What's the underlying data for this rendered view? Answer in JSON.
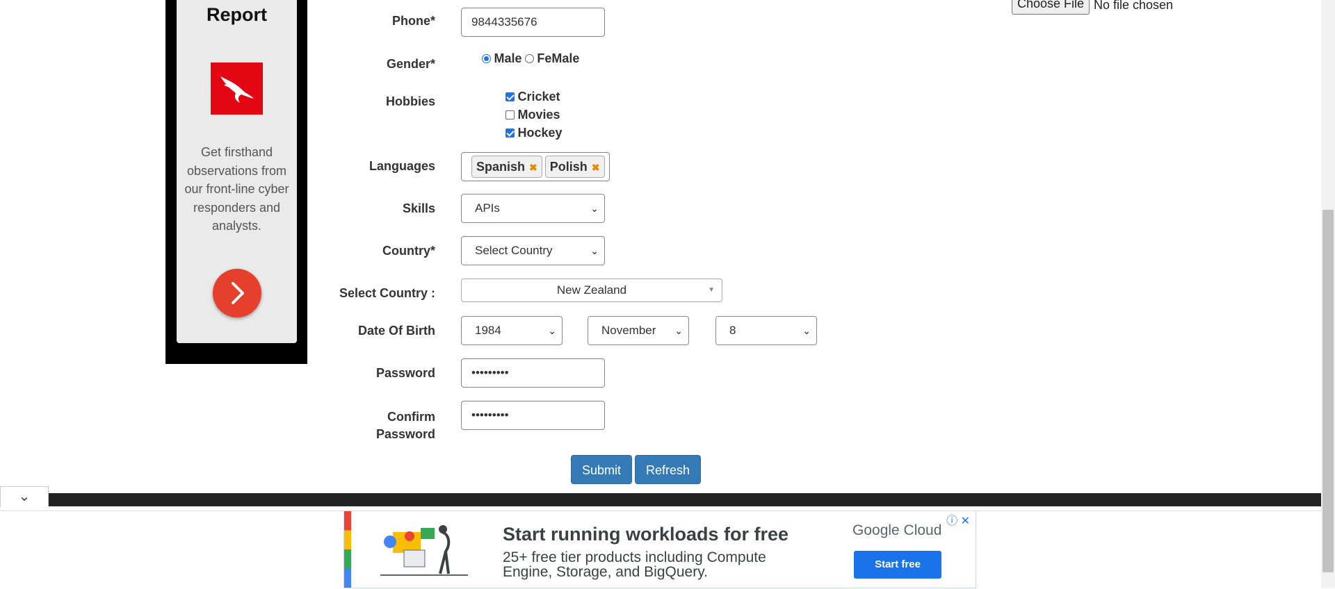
{
  "sidebar_ad": {
    "title": "Report",
    "text": "Get firsthand observations from our front-line cyber responders and analysts.",
    "logo_icon": "eagle-logo-icon",
    "arrow_icon": "chevron-right-icon"
  },
  "file_upload": {
    "button_label": "Choose File",
    "status": "No file chosen"
  },
  "form": {
    "phone": {
      "label": "Phone*",
      "value": "9844335676"
    },
    "gender": {
      "label": "Gender*",
      "options": [
        "Male",
        "FeMale"
      ],
      "selected": "Male"
    },
    "hobbies": {
      "label": "Hobbies",
      "items": [
        {
          "label": "Cricket",
          "checked": true
        },
        {
          "label": "Movies",
          "checked": false
        },
        {
          "label": "Hockey",
          "checked": true
        }
      ]
    },
    "languages": {
      "label": "Languages",
      "tags": [
        "Spanish",
        "Polish"
      ]
    },
    "skills": {
      "label": "Skills",
      "value": "APIs"
    },
    "country": {
      "label": "Country*",
      "value": "Select Country"
    },
    "select_country": {
      "label": "Select Country :",
      "value": "New Zealand"
    },
    "dob": {
      "label": "Date Of Birth",
      "year": "1984",
      "month": "November",
      "day": "8"
    },
    "password": {
      "label": "Password",
      "value": "•••••••••"
    },
    "confirm_password": {
      "label_line1": "Confirm",
      "label_line2": "Password",
      "value": "•••••••••"
    },
    "submit_label": "Submit",
    "refresh_label": "Refresh"
  },
  "ad_banner": {
    "headline": "Start running workloads for free",
    "subtext": "25+ free tier products including Compute Engine, Storage, and BigQuery.",
    "brand": "Google Cloud",
    "cta": "Start free"
  },
  "colors": {
    "primary_button": "#337ab7",
    "ad_red": "#e30613",
    "ad_cta": "#1a73e8"
  }
}
